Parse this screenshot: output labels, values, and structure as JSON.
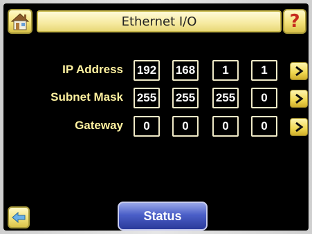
{
  "header": {
    "title": "Ethernet I/O",
    "home_icon": "home-icon",
    "help_label": "?",
    "help_icon": "help-icon"
  },
  "network": {
    "rows": [
      {
        "label": "IP Address",
        "octets": [
          "192",
          "168",
          "1",
          "1"
        ]
      },
      {
        "label": "Subnet Mask",
        "octets": [
          "255",
          "255",
          "255",
          "0"
        ]
      },
      {
        "label": "Gateway",
        "octets": [
          "0",
          "0",
          "0",
          "0"
        ]
      }
    ]
  },
  "footer": {
    "back_icon": "back-arrow-icon",
    "status_label": "Status"
  },
  "colors": {
    "label_yellow": "#fff2a0",
    "accent_yellow": "#f3e27a",
    "status_blue": "#4b5fc8",
    "background": "#000000"
  }
}
